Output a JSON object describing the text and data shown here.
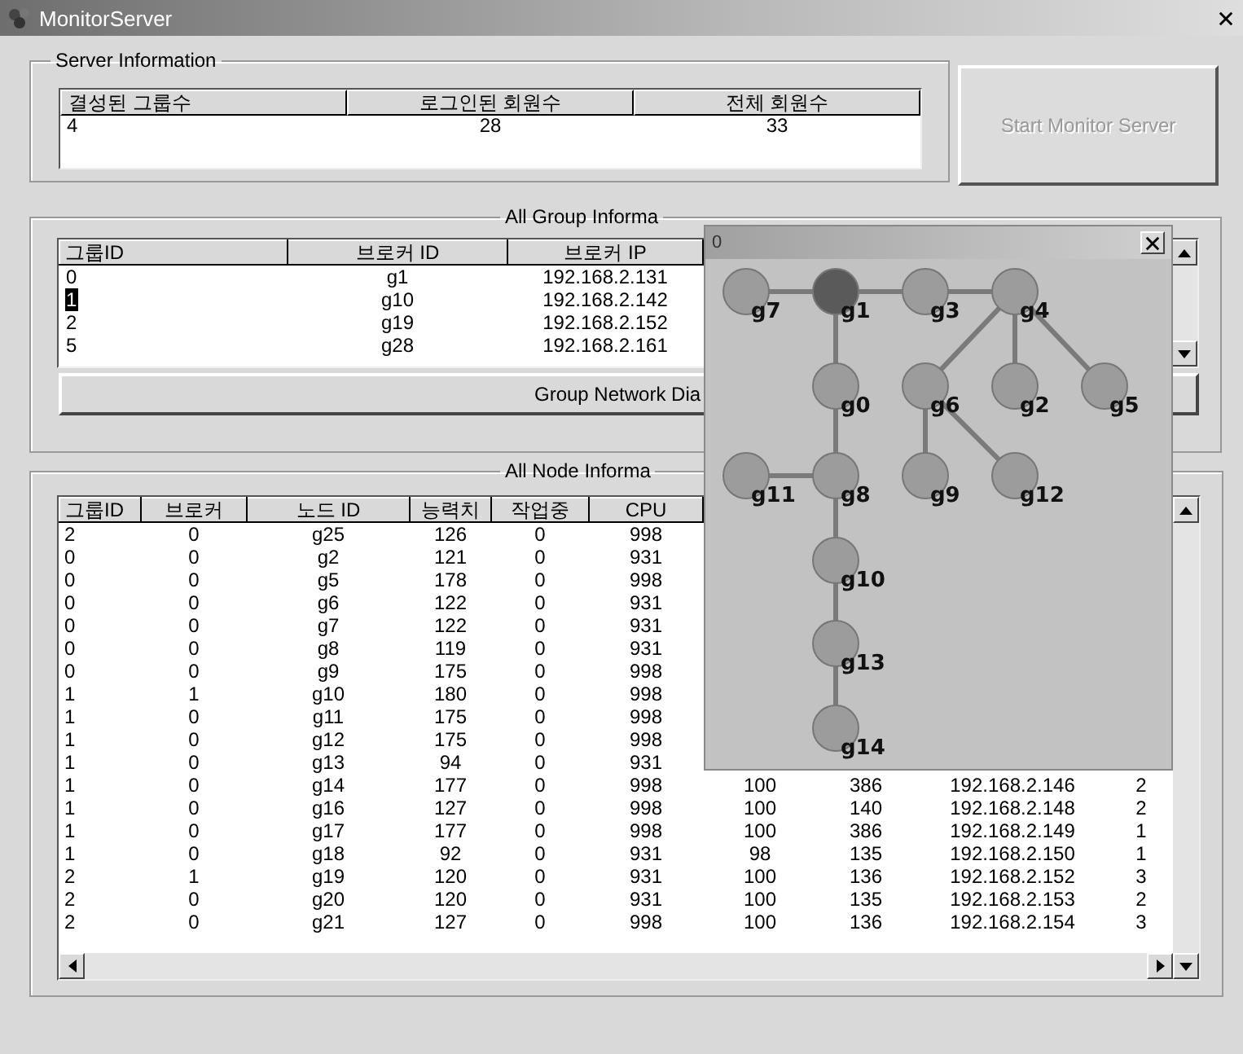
{
  "window": {
    "title": "MonitorServer"
  },
  "server_info": {
    "title": "Server Information",
    "columns": [
      "결성된 그룹수",
      "로그인된 회원수",
      "전체 회원수"
    ],
    "values": [
      "4",
      "28",
      "33"
    ]
  },
  "start_button": {
    "label": "Start Monitor Server",
    "disabled": true
  },
  "group_info": {
    "title": "All Group Informa",
    "columns": [
      "그룹ID",
      "브로커 ID",
      "브로커 IP"
    ],
    "rows": [
      {
        "cells": [
          "0",
          "g1",
          "192.168.2.131"
        ],
        "selected": false
      },
      {
        "cells": [
          "1",
          "g10",
          "192.168.2.142"
        ],
        "selected": true
      },
      {
        "cells": [
          "2",
          "g19",
          "192.168.2.152"
        ],
        "selected": false
      },
      {
        "cells": [
          "5",
          "g28",
          "192.168.2.161"
        ],
        "selected": false
      }
    ],
    "button": "Group Network Dia"
  },
  "node_info": {
    "title": "All Node Informa",
    "columns": [
      "그룹ID",
      "브로커",
      "노드 ID",
      "능력치",
      "작업중",
      "CPU"
    ],
    "rows": [
      {
        "cells": [
          "2",
          "0",
          "g25",
          "126",
          "0",
          "998"
        ]
      },
      {
        "cells": [
          "0",
          "0",
          "g2",
          "121",
          "0",
          "931"
        ]
      },
      {
        "cells": [
          "0",
          "0",
          "g5",
          "178",
          "0",
          "998"
        ]
      },
      {
        "cells": [
          "0",
          "0",
          "g6",
          "122",
          "0",
          "931"
        ]
      },
      {
        "cells": [
          "0",
          "0",
          "g7",
          "122",
          "0",
          "931"
        ]
      },
      {
        "cells": [
          "0",
          "0",
          "g8",
          "119",
          "0",
          "931"
        ]
      },
      {
        "cells": [
          "0",
          "0",
          "g9",
          "175",
          "0",
          "998"
        ]
      },
      {
        "cells": [
          "1",
          "1",
          "g10",
          "180",
          "0",
          "998"
        ]
      },
      {
        "cells": [
          "1",
          "0",
          "g11",
          "175",
          "0",
          "998"
        ]
      },
      {
        "cells": [
          "1",
          "0",
          "g12",
          "175",
          "0",
          "998"
        ]
      },
      {
        "cells": [
          "1",
          "0",
          "g13",
          "94",
          "0",
          "931"
        ]
      },
      {
        "cells": [
          "1",
          "0",
          "g14",
          "177",
          "0",
          "998",
          "100",
          "386",
          "192.168.2.146",
          "2"
        ]
      },
      {
        "cells": [
          "1",
          "0",
          "g16",
          "127",
          "0",
          "998",
          "100",
          "140",
          "192.168.2.148",
          "2"
        ]
      },
      {
        "cells": [
          "1",
          "0",
          "g17",
          "177",
          "0",
          "998",
          "100",
          "386",
          "192.168.2.149",
          "1"
        ]
      },
      {
        "cells": [
          "1",
          "0",
          "g18",
          "92",
          "0",
          "931",
          "98",
          "135",
          "192.168.2.150",
          "1"
        ]
      },
      {
        "cells": [
          "2",
          "1",
          "g19",
          "120",
          "0",
          "931",
          "100",
          "136",
          "192.168.2.152",
          "3"
        ]
      },
      {
        "cells": [
          "2",
          "0",
          "g20",
          "120",
          "0",
          "931",
          "100",
          "135",
          "192.168.2.153",
          "2"
        ]
      },
      {
        "cells": [
          "2",
          "0",
          "g21",
          "127",
          "0",
          "998",
          "100",
          "136",
          "192.168.2.154",
          "3"
        ]
      }
    ]
  },
  "graph_window": {
    "title": "0",
    "nodes": [
      {
        "label": "g7",
        "broker": false
      },
      {
        "label": "g1",
        "broker": true
      },
      {
        "label": "g3",
        "broker": false
      },
      {
        "label": "g4",
        "broker": false
      },
      {
        "label": "g0",
        "broker": false
      },
      {
        "label": "g6",
        "broker": false
      },
      {
        "label": "g2",
        "broker": false
      },
      {
        "label": "g5",
        "broker": false
      },
      {
        "label": "g11",
        "broker": false
      },
      {
        "label": "g8",
        "broker": false
      },
      {
        "label": "g9",
        "broker": false
      },
      {
        "label": "g12",
        "broker": false
      },
      {
        "label": "g10",
        "broker": false
      },
      {
        "label": "g13",
        "broker": false
      },
      {
        "label": "g14",
        "broker": false
      }
    ]
  }
}
